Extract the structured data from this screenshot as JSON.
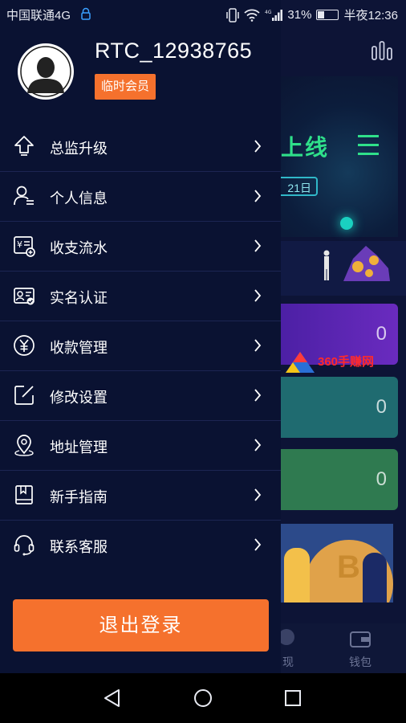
{
  "status_bar": {
    "carrier": "中国联通4G",
    "battery": "31%",
    "time": "半夜12:36"
  },
  "profile": {
    "username": "RTC_12938765",
    "member_badge": "临时会员"
  },
  "menu": {
    "items": [
      {
        "label": "总监升级",
        "icon": "upgrade-bulb-icon"
      },
      {
        "label": "个人信息",
        "icon": "user-info-icon"
      },
      {
        "label": "收支流水",
        "icon": "ledger-icon"
      },
      {
        "label": "实名认证",
        "icon": "id-card-icon"
      },
      {
        "label": "收款管理",
        "icon": "yuan-coin-icon"
      },
      {
        "label": "修改设置",
        "icon": "edit-icon"
      },
      {
        "label": "地址管理",
        "icon": "location-pin-icon"
      },
      {
        "label": "新手指南",
        "icon": "guide-book-icon"
      },
      {
        "label": "联系客服",
        "icon": "headset-icon"
      }
    ]
  },
  "logout_label": "退出登录",
  "background": {
    "banner_text": "上线",
    "banner_date": "21日",
    "card_values": [
      "0",
      "0",
      "0"
    ],
    "watermark_text": "360手赚网",
    "tabs": [
      "现",
      "钱包"
    ]
  },
  "colors": {
    "drawer_bg": "#0a1232",
    "accent_orange": "#f5712d"
  }
}
